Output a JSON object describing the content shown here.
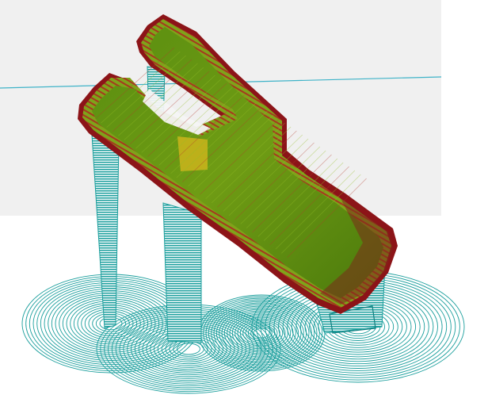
{
  "viewer": {
    "background_color": "#ffffff",
    "build_plate_color": "#f0f0f0",
    "grid_line_color": "#3fb3c8"
  },
  "toolpath_colors": {
    "support": "#1a9e9c",
    "support_dark": "#0f7f80",
    "wall_outer": "#8c1418",
    "wall_inner": "#b23a2a",
    "infill": "#6a9a12",
    "infill_light": "#95bd28",
    "top_skin": "#c6b31c"
  },
  "icons": {
    "model": "sliced-model-icon"
  }
}
